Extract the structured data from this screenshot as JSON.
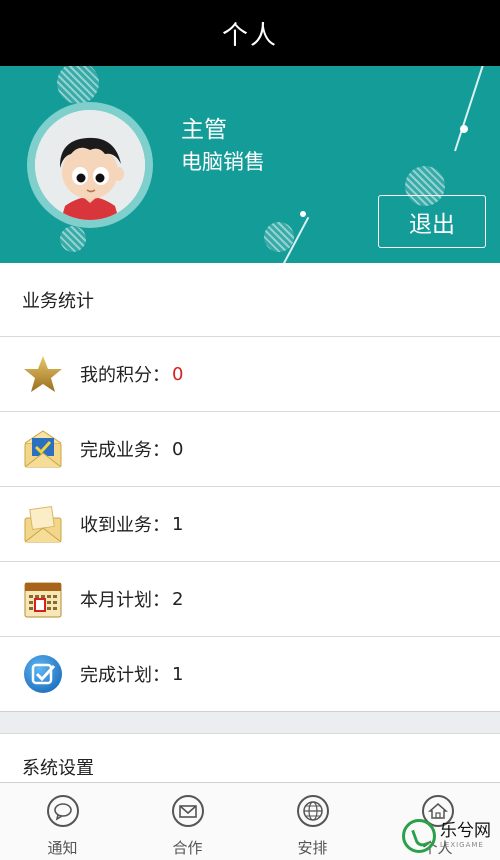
{
  "header": {
    "title": "个人"
  },
  "profile": {
    "name": "主管",
    "department": "电脑销售",
    "logout_label": "退出",
    "avatar": "cartoon-boy-avatar"
  },
  "stats": {
    "section_title": "业务统计",
    "items": [
      {
        "icon": "star-icon",
        "label": "我的积分：",
        "value": "0",
        "value_color": "#d32222"
      },
      {
        "icon": "envelope-check-icon",
        "label": "完成业务：",
        "value": "0"
      },
      {
        "icon": "open-envelope-icon",
        "label": "收到业务：",
        "value": "1"
      },
      {
        "icon": "calendar-icon",
        "label": "本月计划：",
        "value": "2"
      },
      {
        "icon": "checkbox-icon",
        "label": "完成计划：",
        "value": "1"
      }
    ]
  },
  "settings": {
    "section_title": "系统设置"
  },
  "tabbar": {
    "tabs": [
      {
        "icon": "chat-bubble-icon",
        "label": "通知"
      },
      {
        "icon": "mail-icon",
        "label": "合作"
      },
      {
        "icon": "globe-icon",
        "label": "安排"
      },
      {
        "icon": "home-icon",
        "label": "个人"
      }
    ]
  },
  "watermark": {
    "text": "乐兮网",
    "subtext": "LEXIGAME"
  },
  "colors": {
    "accent": "#139c98",
    "topbar": "#000000",
    "highlight_value": "#d32222"
  }
}
